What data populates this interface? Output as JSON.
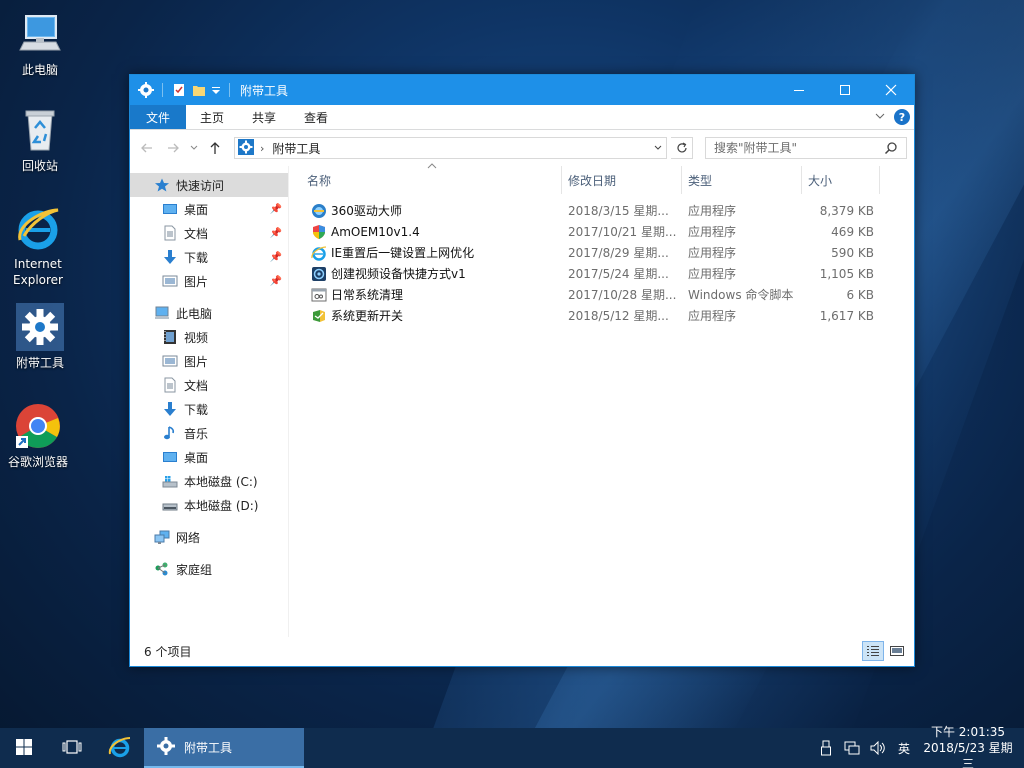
{
  "desktop": {
    "icons": [
      {
        "label": "此电脑",
        "icon": "computer-icon"
      },
      {
        "label": "回收站",
        "icon": "recycle-bin-icon"
      },
      {
        "label": "Internet Explorer",
        "icon": "ie-icon"
      },
      {
        "label": "附带工具",
        "icon": "gear-icon"
      },
      {
        "label": "谷歌浏览器",
        "icon": "chrome-icon"
      }
    ]
  },
  "window": {
    "title": "附带工具",
    "ribbon_tabs": [
      "文件",
      "主页",
      "共享",
      "查看"
    ],
    "help": "?",
    "address": {
      "crumb": "附带工具"
    },
    "search": {
      "placeholder": "搜索\"附带工具\""
    },
    "nav": {
      "quick_access": "快速访问",
      "quick_items": [
        "桌面",
        "文档",
        "下载",
        "图片"
      ],
      "this_pc": "此电脑",
      "pc_items": [
        "视频",
        "图片",
        "文档",
        "下载",
        "音乐",
        "桌面",
        "本地磁盘 (C:)",
        "本地磁盘 (D:)"
      ],
      "network": "网络",
      "homegroup": "家庭组"
    },
    "columns": {
      "name": "名称",
      "date": "修改日期",
      "type": "类型",
      "size": "大小"
    },
    "files": [
      {
        "name": "360驱动大师",
        "date": "2018/3/15 星期...",
        "type": "应用程序",
        "size": "8,379 KB",
        "icon": "driver-app-icon"
      },
      {
        "name": "AmOEM10v1.4",
        "date": "2017/10/21 星期...",
        "type": "应用程序",
        "size": "469 KB",
        "icon": "shield-app-icon"
      },
      {
        "name": "IE重置后一键设置上网优化",
        "date": "2017/8/29 星期...",
        "type": "应用程序",
        "size": "590 KB",
        "icon": "ie-app-icon"
      },
      {
        "name": "创建视频设备快捷方式v1",
        "date": "2017/5/24 星期...",
        "type": "应用程序",
        "size": "1,105 KB",
        "icon": "video-app-icon"
      },
      {
        "name": "日常系统清理",
        "date": "2017/10/28 星期...",
        "type": "Windows 命令脚本",
        "size": "6 KB",
        "icon": "script-icon"
      },
      {
        "name": "系统更新开关",
        "date": "2018/5/12 星期...",
        "type": "应用程序",
        "size": "1,617 KB",
        "icon": "update-app-icon"
      }
    ],
    "status": "6 个项目"
  },
  "taskbar": {
    "active_app": "附带工具",
    "ime": "英",
    "time": "下午 2:01:35",
    "date": "2018/5/23 星期三"
  },
  "colors": {
    "titlebar": "#1e90e8",
    "file_tab": "#1979ca",
    "taskbar": "#0f2c4e"
  }
}
